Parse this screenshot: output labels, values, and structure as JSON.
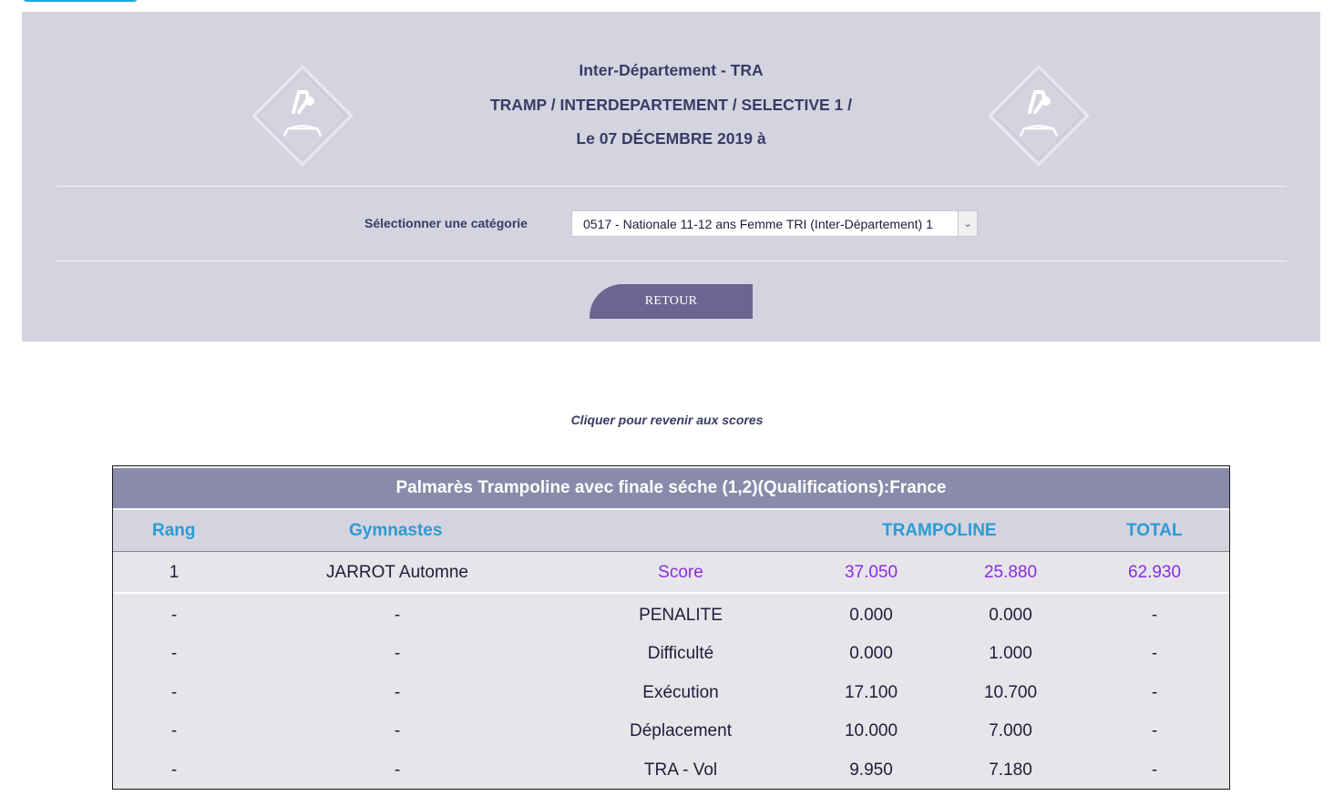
{
  "event": {
    "name": "Inter-Département - TRA",
    "path": "TRAMP / INTERDEPARTEMENT / SELECTIVE 1 /",
    "date": "Le 07 DÉCEMBRE 2019 à"
  },
  "category": {
    "label": "Sélectionner une catégorie",
    "selected": "0517 - Nationale 11-12 ans Femme TRI (Inter-Département) 1"
  },
  "buttons": {
    "retour": "RETOUR"
  },
  "back_link": "Cliquer pour revenir aux scores",
  "colors": {
    "panel": "#d4d4e0",
    "accent": "#6a6690",
    "header_text": "#2b9bd6",
    "score_text": "#8a2be2"
  },
  "table": {
    "title": "Palmarès Trampoline avec finale séche (1,2)(Qualifications):France",
    "headers": {
      "rang": "Rang",
      "gymnastes": "Gymnastes",
      "trampoline": "TRAMPOLINE",
      "total": "TOTAL"
    },
    "score_row": {
      "rank": "1",
      "name": "JARROT Automne",
      "label": "Score",
      "v1": "37.050",
      "v2": "25.880",
      "total": "62.930"
    },
    "details": [
      {
        "rank": "-",
        "name": "-",
        "label": "PENALITE",
        "v1": "0.000",
        "v2": "0.000",
        "total": "-"
      },
      {
        "rank": "-",
        "name": "-",
        "label": "Difficulté",
        "v1": "0.000",
        "v2": "1.000",
        "total": "-"
      },
      {
        "rank": "-",
        "name": "-",
        "label": "Exécution",
        "v1": "17.100",
        "v2": "10.700",
        "total": "-"
      },
      {
        "rank": "-",
        "name": "-",
        "label": "Déplacement",
        "v1": "10.000",
        "v2": "7.000",
        "total": "-"
      },
      {
        "rank": "-",
        "name": "-",
        "label": "TRA - Vol",
        "v1": "9.950",
        "v2": "7.180",
        "total": "-"
      }
    ]
  }
}
